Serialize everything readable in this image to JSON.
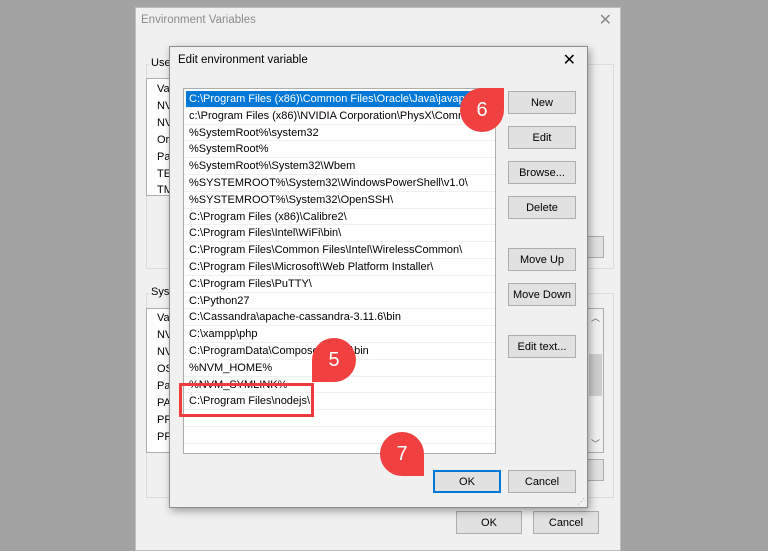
{
  "outer_window": {
    "title": "Environment Variables",
    "user_group_label": "User",
    "user_rows": [
      "Va",
      "NV",
      "NV",
      "Or",
      "Pa",
      "TE",
      "TM"
    ],
    "system_group_label": "Syste",
    "system_rows": [
      "Va",
      "NV",
      "NV",
      "OS",
      "Pa",
      "PA",
      "PR",
      "PR"
    ],
    "ok_label": "OK",
    "cancel_label": "Cancel"
  },
  "dialog": {
    "title": "Edit environment variable",
    "entries": [
      "C:\\Program Files (x86)\\Common Files\\Oracle\\Java\\javapath",
      "c:\\Program Files (x86)\\NVIDIA Corporation\\PhysX\\Common",
      "%SystemRoot%\\system32",
      "%SystemRoot%",
      "%SystemRoot%\\System32\\Wbem",
      "%SYSTEMROOT%\\System32\\WindowsPowerShell\\v1.0\\",
      "%SYSTEMROOT%\\System32\\OpenSSH\\",
      "C:\\Program Files (x86)\\Calibre2\\",
      "C:\\Program Files\\Intel\\WiFi\\bin\\",
      "C:\\Program Files\\Common Files\\Intel\\WirelessCommon\\",
      "C:\\Program Files\\Microsoft\\Web Platform Installer\\",
      "C:\\Program Files\\PuTTY\\",
      "C:\\Python27",
      "C:\\Cassandra\\apache-cassandra-3.11.6\\bin",
      "C:\\xampp\\php",
      "C:\\ProgramData\\ComposerSetup\\bin",
      "%NVM_HOME%",
      "%NVM_SYMLINK%",
      "C:\\Program Files\\nodejs\\"
    ],
    "selected_index": 0,
    "buttons": {
      "new": "New",
      "edit": "Edit",
      "browse": "Browse...",
      "delete": "Delete",
      "move_up": "Move Up",
      "move_down": "Move Down",
      "edit_text": "Edit text...",
      "ok": "OK",
      "cancel": "Cancel"
    }
  },
  "callouts": {
    "step5": "5",
    "step6": "6",
    "step7": "7",
    "color": "#f04040"
  },
  "accent_color": "#0078d7"
}
